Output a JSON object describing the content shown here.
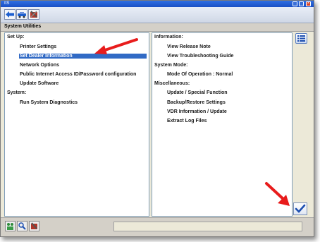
{
  "window": {
    "title": "ItS"
  },
  "toolbar": {
    "icons": [
      "back-arrow-icon",
      "vehicle-icon",
      "tools-icon"
    ]
  },
  "section": {
    "title": "System Utilities"
  },
  "left_panel": {
    "setup_header": "Set Up:",
    "setup_items": [
      "Printer Settings",
      "Set Dealer Information",
      "Network Options",
      "Public Internet Access ID/Password configuration",
      "Update Software"
    ],
    "selected_index": 1,
    "system_header": "System:",
    "system_items": [
      "Run System Diagnostics"
    ]
  },
  "right_panel": {
    "information_header": "Information:",
    "information_items": [
      "View Release Note",
      "View Troubleshooting Guide"
    ],
    "system_mode_header": "System Mode:",
    "system_mode_items": [
      "Mode Of Operation : Normal"
    ],
    "misc_header": "Miscellaneous:",
    "misc_items": [
      "Update / Special Function",
      "Backup/Restore Settings",
      "VDR Information / Update",
      "Extract Log Files"
    ]
  },
  "annotation": {
    "arrow_color": "#e81c1c"
  },
  "colors": {
    "selection": "#316ac5",
    "titlebar": "#2f6fe3"
  }
}
